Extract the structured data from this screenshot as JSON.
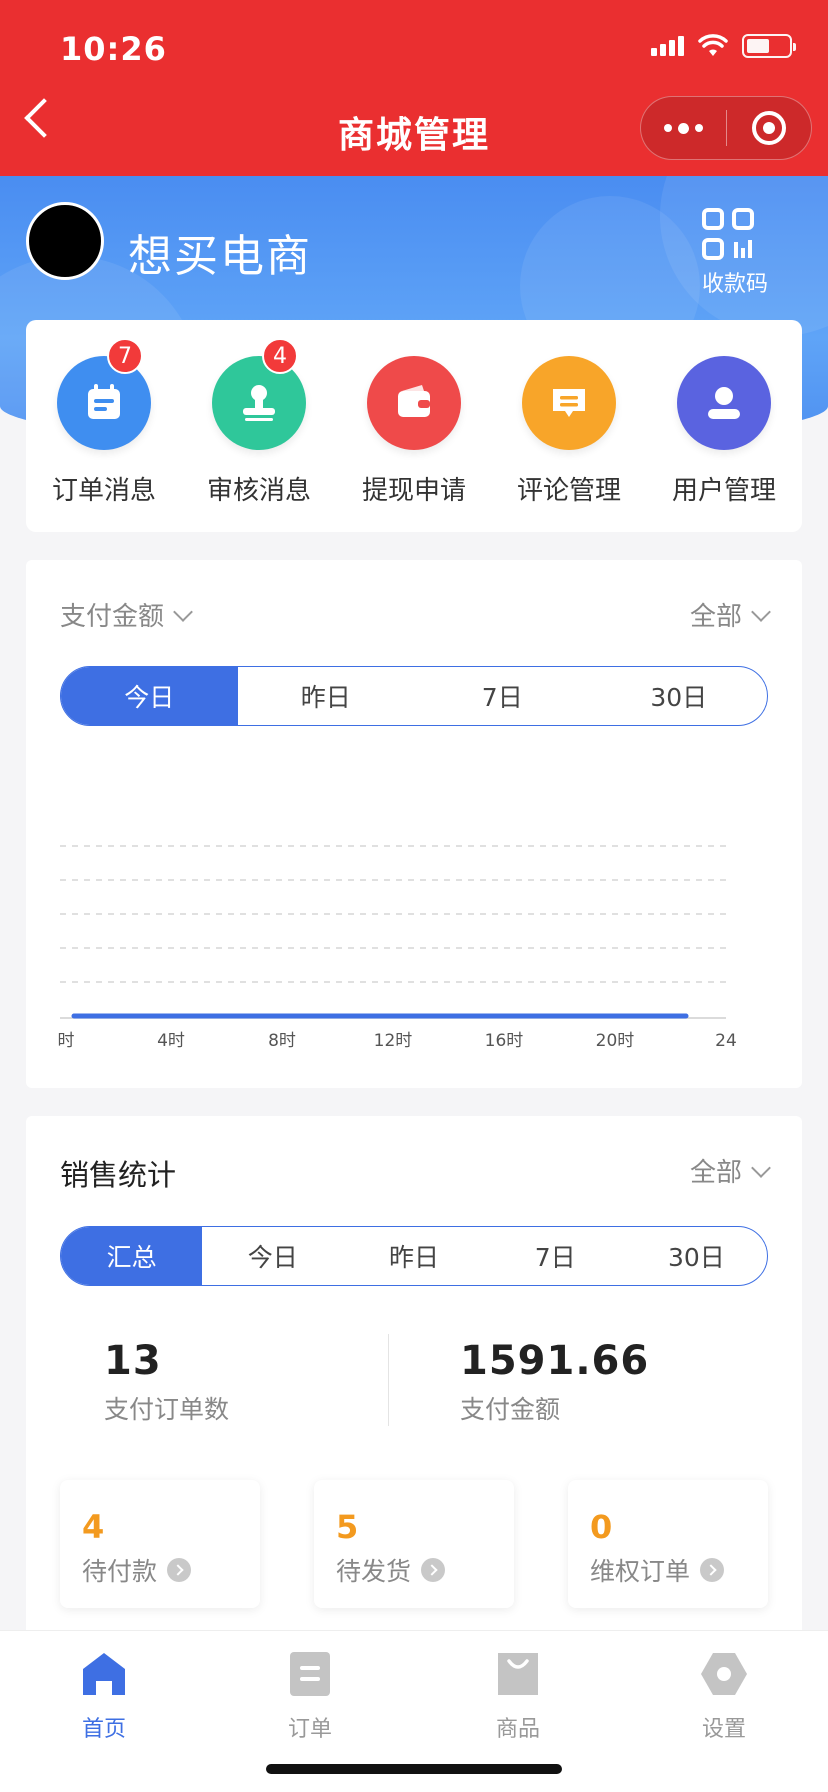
{
  "status_bar": {
    "time": "10:26",
    "battery_level": 0.55
  },
  "nav": {
    "title": "商城管理"
  },
  "header": {
    "shop_name": "想买电商",
    "qr_label": "收款码"
  },
  "quick_actions": [
    {
      "label": "订单消息",
      "badge": "7",
      "icon": "calendar-icon",
      "color": "#3f8ef0"
    },
    {
      "label": "审核消息",
      "badge": "4",
      "icon": "stamp-icon",
      "color": "#2fc79a"
    },
    {
      "label": "提现申请",
      "badge": "",
      "icon": "wallet-icon",
      "color": "#ef4a4a"
    },
    {
      "label": "评论管理",
      "badge": "",
      "icon": "comment-icon",
      "color": "#f8a529"
    },
    {
      "label": "用户管理",
      "badge": "",
      "icon": "user-icon",
      "color": "#5a63e0"
    }
  ],
  "payment_card": {
    "metric_select": "支付金额",
    "scope_select": "全部",
    "tabs": [
      "今日",
      "昨日",
      "7日",
      "30日"
    ],
    "active_tab": 0
  },
  "chart_data": {
    "type": "line",
    "title": "",
    "xlabel": "",
    "ylabel": "",
    "tick_labels": [
      "时",
      "4时",
      "8时",
      "12时",
      "16时",
      "20时",
      "24"
    ],
    "x": [
      0,
      4,
      8,
      12,
      16,
      20,
      24
    ],
    "series": [
      {
        "values": [
          0,
          0,
          0,
          0,
          0,
          0,
          0
        ]
      }
    ],
    "grid": "horizontal dashed",
    "series_color": "#3e6fe3"
  },
  "sales_card": {
    "title": "销售统计",
    "scope_select": "全部",
    "tabs": [
      "汇总",
      "今日",
      "昨日",
      "7日",
      "30日"
    ],
    "active_tab": 0,
    "paid_orders_value": "13",
    "paid_orders_label": "支付订单数",
    "paid_amount_value": "1591.66",
    "paid_amount_label": "支付金额",
    "pending": [
      {
        "value": "4",
        "label": "待付款"
      },
      {
        "value": "5",
        "label": "待发货"
      },
      {
        "value": "0",
        "label": "维权订单"
      }
    ]
  },
  "tabbar": [
    {
      "label": "首页",
      "icon": "home-icon",
      "active": true
    },
    {
      "label": "订单",
      "icon": "order-icon",
      "active": false
    },
    {
      "label": "商品",
      "icon": "bag-icon",
      "active": false
    },
    {
      "label": "设置",
      "icon": "settings-icon",
      "active": false
    }
  ],
  "colors": {
    "brand_red": "#ea2f30",
    "accent_blue": "#3e6fe3",
    "pending_orange": "#f39a1f"
  }
}
